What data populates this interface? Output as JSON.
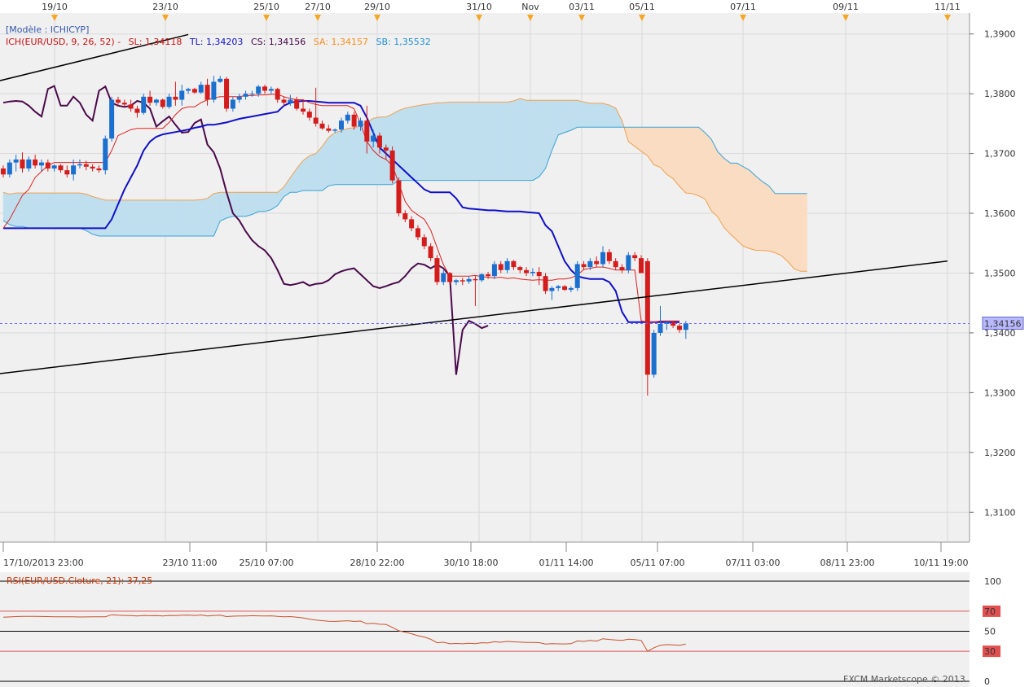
{
  "chart_data": {
    "type": "candlestick",
    "template_label": "[Modèle : ICHICYP]",
    "legend": {
      "ich": "ICH(EUR/USD, 9, 26, 52) -",
      "sl": "SL: 1,34118",
      "tl": "TL: 1,34203",
      "cs": "CS: 1,34156",
      "sa": "SA: 1,34157",
      "sb": "SB: 1,35532"
    },
    "current_price": "1,34156",
    "y_ticks": [
      "1,3900",
      "1,3800",
      "1,3700",
      "1,3600",
      "1,3500",
      "1,3400",
      "1,3300",
      "1,3200",
      "1,3100"
    ],
    "y_range": [
      1.305,
      1.3935
    ],
    "top_dates": [
      "19/10",
      "23/10",
      "25/10",
      "27/10",
      "29/10",
      "31/10",
      "Nov",
      "03/11",
      "05/11",
      "07/11",
      "09/11",
      "11/11"
    ],
    "bottom_dates": [
      "17/10/2013 23:00",
      "23/10 11:00",
      "25/10 07:00",
      "28/10 22:00",
      "30/10 18:00",
      "01/11 14:00",
      "05/11 07:00",
      "07/11 03:00",
      "08/11 23:00",
      "10/11 19:00"
    ],
    "candles": [
      [
        1.3675,
        1.368,
        1.366,
        1.3665
      ],
      [
        1.3665,
        1.369,
        1.366,
        1.3685
      ],
      [
        1.3685,
        1.3698,
        1.367,
        1.369
      ],
      [
        1.369,
        1.3702,
        1.3668,
        1.3675
      ],
      [
        1.3675,
        1.3695,
        1.367,
        1.369
      ],
      [
        1.369,
        1.3698,
        1.3675,
        1.368
      ],
      [
        1.368,
        1.369,
        1.367,
        1.3685
      ],
      [
        1.3685,
        1.369,
        1.367,
        1.3675
      ],
      [
        1.3675,
        1.3682,
        1.367,
        1.368
      ],
      [
        1.368,
        1.3682,
        1.3668,
        1.3672
      ],
      [
        1.3672,
        1.368,
        1.366,
        1.3665
      ],
      [
        1.3665,
        1.369,
        1.3655,
        1.368
      ],
      [
        1.368,
        1.369,
        1.3675,
        1.3682
      ],
      [
        1.3682,
        1.3688,
        1.3672,
        1.3678
      ],
      [
        1.3678,
        1.3682,
        1.367,
        1.3675
      ],
      [
        1.3675,
        1.368,
        1.3668,
        1.3672
      ],
      [
        1.3672,
        1.373,
        1.3665,
        1.3725
      ],
      [
        1.3725,
        1.3795,
        1.372,
        1.379
      ],
      [
        1.379,
        1.3795,
        1.378,
        1.3785
      ],
      [
        1.3785,
        1.379,
        1.3778,
        1.3782
      ],
      [
        1.3782,
        1.379,
        1.377,
        1.3775
      ],
      [
        1.3775,
        1.378,
        1.376,
        1.3768
      ],
      [
        1.3768,
        1.38,
        1.3765,
        1.3795
      ],
      [
        1.3795,
        1.3805,
        1.378,
        1.3785
      ],
      [
        1.3785,
        1.3792,
        1.378,
        1.379
      ],
      [
        1.379,
        1.3792,
        1.3775,
        1.3778
      ],
      [
        1.3778,
        1.38,
        1.3775,
        1.3795
      ],
      [
        1.3795,
        1.382,
        1.378,
        1.379
      ],
      [
        1.379,
        1.3815,
        1.378,
        1.3805
      ],
      [
        1.3805,
        1.381,
        1.38,
        1.3808
      ],
      [
        1.3808,
        1.381,
        1.38,
        1.3802
      ],
      [
        1.3802,
        1.382,
        1.38,
        1.3815
      ],
      [
        1.3815,
        1.3825,
        1.378,
        1.379
      ],
      [
        1.379,
        1.383,
        1.3785,
        1.382
      ],
      [
        1.382,
        1.383,
        1.3818,
        1.3825
      ],
      [
        1.3825,
        1.3828,
        1.377,
        1.3775
      ],
      [
        1.3775,
        1.3795,
        1.377,
        1.379
      ],
      [
        1.379,
        1.38,
        1.3785,
        1.3795
      ],
      [
        1.3795,
        1.3805,
        1.379,
        1.38
      ],
      [
        1.38,
        1.3805,
        1.3795,
        1.38
      ],
      [
        1.38,
        1.3815,
        1.3795,
        1.3812
      ],
      [
        1.3812,
        1.3815,
        1.38,
        1.3805
      ],
      [
        1.3805,
        1.3812,
        1.38,
        1.3808
      ],
      [
        1.3808,
        1.381,
        1.3785,
        1.379
      ],
      [
        1.379,
        1.3795,
        1.378,
        1.3785
      ],
      [
        1.3785,
        1.3798,
        1.378,
        1.379
      ],
      [
        1.379,
        1.3795,
        1.3772,
        1.3775
      ],
      [
        1.3775,
        1.379,
        1.3765,
        1.377
      ],
      [
        1.377,
        1.3775,
        1.3755,
        1.376
      ],
      [
        1.376,
        1.381,
        1.3745,
        1.375
      ],
      [
        1.375,
        1.3755,
        1.374,
        1.3742
      ],
      [
        1.3742,
        1.3748,
        1.3735,
        1.3738
      ],
      [
        1.3738,
        1.3742,
        1.3735,
        1.374
      ],
      [
        1.374,
        1.376,
        1.3735,
        1.3755
      ],
      [
        1.3755,
        1.377,
        1.375,
        1.3765
      ],
      [
        1.3765,
        1.377,
        1.374,
        1.3745
      ],
      [
        1.3745,
        1.376,
        1.3738,
        1.3755
      ],
      [
        1.3755,
        1.378,
        1.37,
        1.372
      ],
      [
        1.372,
        1.374,
        1.371,
        1.373
      ],
      [
        1.373,
        1.3735,
        1.37,
        1.371
      ],
      [
        1.371,
        1.3715,
        1.369,
        1.3705
      ],
      [
        1.3705,
        1.3712,
        1.365,
        1.3655
      ],
      [
        1.3655,
        1.366,
        1.3595,
        1.36
      ],
      [
        1.36,
        1.3605,
        1.3585,
        1.359
      ],
      [
        1.359,
        1.3595,
        1.357,
        1.3575
      ],
      [
        1.3575,
        1.358,
        1.3555,
        1.356
      ],
      [
        1.356,
        1.3565,
        1.354,
        1.3545
      ],
      [
        1.3545,
        1.355,
        1.352,
        1.3525
      ],
      [
        1.3525,
        1.353,
        1.348,
        1.3485
      ],
      [
        1.3485,
        1.3505,
        1.348,
        1.35
      ],
      [
        1.35,
        1.3502,
        1.348,
        1.3485
      ],
      [
        1.3485,
        1.349,
        1.348,
        1.3488
      ],
      [
        1.3488,
        1.3492,
        1.348,
        1.3486
      ],
      [
        1.3486,
        1.3495,
        1.3482,
        1.349
      ],
      [
        1.349,
        1.3495,
        1.3445,
        1.3488
      ],
      [
        1.3488,
        1.35,
        1.3485,
        1.3498
      ],
      [
        1.3498,
        1.3502,
        1.349,
        1.3495
      ],
      [
        1.3495,
        1.352,
        1.349,
        1.3515
      ],
      [
        1.3515,
        1.352,
        1.35,
        1.3505
      ],
      [
        1.3505,
        1.3525,
        1.35,
        1.352
      ],
      [
        1.352,
        1.3522,
        1.3505,
        1.351
      ],
      [
        1.351,
        1.3512,
        1.35,
        1.3505
      ],
      [
        1.3505,
        1.351,
        1.3495,
        1.35
      ],
      [
        1.35,
        1.3508,
        1.3495,
        1.3502
      ],
      [
        1.3502,
        1.351,
        1.348,
        1.3495
      ],
      [
        1.3495,
        1.35,
        1.3465,
        1.347
      ],
      [
        1.347,
        1.3478,
        1.3455,
        1.3475
      ],
      [
        1.3475,
        1.348,
        1.347,
        1.3478
      ],
      [
        1.3478,
        1.348,
        1.347,
        1.3472
      ],
      [
        1.3472,
        1.3478,
        1.3468,
        1.3475
      ],
      [
        1.3475,
        1.352,
        1.347,
        1.3515
      ],
      [
        1.3515,
        1.352,
        1.3505,
        1.351
      ],
      [
        1.351,
        1.3525,
        1.3505,
        1.352
      ],
      [
        1.352,
        1.3528,
        1.351,
        1.3515
      ],
      [
        1.3515,
        1.3545,
        1.351,
        1.3535
      ],
      [
        1.3535,
        1.354,
        1.3515,
        1.352
      ],
      [
        1.352,
        1.3525,
        1.3505,
        1.351
      ],
      [
        1.351,
        1.3515,
        1.35,
        1.3505
      ],
      [
        1.3505,
        1.3535,
        1.35,
        1.353
      ],
      [
        1.353,
        1.3535,
        1.352,
        1.3525
      ],
      [
        1.3525,
        1.353,
        1.35,
        1.35
      ],
      [
        1.352,
        1.3525,
        1.3295,
        1.333
      ],
      [
        1.333,
        1.3405,
        1.3325,
        1.34
      ],
      [
        1.34,
        1.3445,
        1.3395,
        1.3415
      ],
      [
        1.3415,
        1.342,
        1.3405,
        1.3418
      ],
      [
        1.3418,
        1.342,
        1.3408,
        1.3412
      ],
      [
        1.3412,
        1.3415,
        1.34,
        1.3405
      ],
      [
        1.3405,
        1.342,
        1.339,
        1.3416
      ]
    ],
    "tenkan_sen": [
      1.3575,
      1.359,
      1.361,
      1.363,
      1.364,
      1.366,
      1.367,
      1.368,
      1.3685,
      1.3685,
      1.3685,
      1.3685,
      1.3685,
      1.3685,
      1.3685,
      1.3685,
      1.3685,
      1.3705,
      1.373,
      1.3735,
      1.374,
      1.3742,
      1.3742,
      1.3742,
      1.3742,
      1.3742,
      1.3752,
      1.3765,
      1.3775,
      1.3778,
      1.3778,
      1.3785,
      1.379,
      1.3793,
      1.3795,
      1.3795,
      1.3795,
      1.3795,
      1.3797,
      1.3797,
      1.3798,
      1.3798,
      1.3799,
      1.3799,
      1.3795,
      1.3792,
      1.379,
      1.379,
      1.3785,
      1.3782,
      1.378,
      1.378,
      1.378,
      1.378,
      1.378,
      1.3775,
      1.375,
      1.372,
      1.3705,
      1.3695,
      1.369,
      1.368,
      1.365,
      1.362,
      1.3605,
      1.3597,
      1.359,
      1.3572,
      1.3543,
      1.3514,
      1.3495,
      1.3495,
      1.3495,
      1.3495,
      1.3496,
      1.3494,
      1.3493,
      1.3492,
      1.3493,
      1.3491,
      1.3492,
      1.349,
      1.3489,
      1.3488,
      1.3489,
      1.3488,
      1.3488,
      1.349,
      1.349,
      1.3492,
      1.3497,
      1.3506,
      1.3508,
      1.351,
      1.351,
      1.3508,
      1.3505,
      1.3505,
      1.3505,
      1.3505,
      1.342,
      1.3418,
      1.3418,
      1.342,
      1.342,
      1.342,
      1.342
    ],
    "kijun_sen": [
      1.3575,
      1.3575,
      1.3575,
      1.3575,
      1.3575,
      1.3575,
      1.3575,
      1.3575,
      1.3575,
      1.3575,
      1.3575,
      1.3575,
      1.3575,
      1.3575,
      1.3575,
      1.3575,
      1.3575,
      1.359,
      1.3615,
      1.364,
      1.366,
      1.368,
      1.3705,
      1.372,
      1.3728,
      1.3732,
      1.3734,
      1.3736,
      1.3738,
      1.374,
      1.3743,
      1.3745,
      1.3748,
      1.3748,
      1.375,
      1.3752,
      1.3755,
      1.3758,
      1.376,
      1.3762,
      1.3764,
      1.3766,
      1.3768,
      1.377,
      1.378,
      1.3785,
      1.3787,
      1.3788,
      1.3788,
      1.3787,
      1.3786,
      1.3785,
      1.3785,
      1.3785,
      1.3785,
      1.3785,
      1.378,
      1.376,
      1.3735,
      1.371,
      1.37,
      1.369,
      1.368,
      1.367,
      1.366,
      1.365,
      1.364,
      1.3635,
      1.3635,
      1.3635,
      1.3635,
      1.3625,
      1.361,
      1.3608,
      1.3607,
      1.3606,
      1.3605,
      1.3605,
      1.3604,
      1.3603,
      1.3603,
      1.3603,
      1.3602,
      1.3601,
      1.36,
      1.358,
      1.357,
      1.3545,
      1.352,
      1.3505,
      1.3495,
      1.3492,
      1.349,
      1.349,
      1.349,
      1.3485,
      1.347,
      1.3435,
      1.3418,
      1.3418,
      1.3418,
      1.3418,
      1.3418,
      1.3418,
      1.3418,
      1.3418,
      1.3418
    ],
    "chikou_span": [
      1.3785,
      1.3787,
      1.3788,
      1.3787,
      1.378,
      1.377,
      1.3762,
      1.3808,
      1.3813,
      1.378,
      1.378,
      1.3795,
      1.3785,
      1.3765,
      1.3755,
      1.3805,
      1.3812,
      1.3785,
      1.378,
      1.3778,
      1.378,
      1.3788,
      1.3785,
      1.3775,
      1.3745,
      1.3754,
      1.3762,
      1.3748,
      1.3735,
      1.3736,
      1.3751,
      1.3757,
      1.3715,
      1.3702,
      1.3675,
      1.3635,
      1.36,
      1.3588,
      1.357,
      1.3555,
      1.3545,
      1.3538,
      1.3525,
      1.3505,
      1.3482,
      1.348,
      1.3482,
      1.3485,
      1.3479,
      1.3482,
      1.3483,
      1.3488,
      1.3498,
      1.3503,
      1.3506,
      1.3508,
      1.3498,
      1.3488,
      1.3478,
      1.3475,
      1.3478,
      1.3482,
      1.3485,
      1.3495,
      1.3508,
      1.3516,
      1.3514,
      1.3508,
      1.3514,
      1.3508,
      1.3495,
      1.333,
      1.3405,
      1.342,
      1.3415,
      1.3408,
      1.3412
    ],
    "senkou_a": [
      1.3635,
      1.3632,
      1.3634,
      1.3634,
      1.3634,
      1.3634,
      1.3634,
      1.3634,
      1.3634,
      1.3634,
      1.3634,
      1.3634,
      1.3634,
      1.3632,
      1.3628,
      1.3625,
      1.3622,
      1.3622,
      1.3622,
      1.3622,
      1.3622,
      1.3622,
      1.3622,
      1.3622,
      1.3622,
      1.3622,
      1.3622,
      1.3622,
      1.3622,
      1.3622,
      1.3622,
      1.3623,
      1.3625,
      1.3633,
      1.3635,
      1.3635,
      1.3635,
      1.3635,
      1.3635,
      1.3635,
      1.3635,
      1.3635,
      1.3635,
      1.3635,
      1.3644,
      1.366,
      1.3675,
      1.3688,
      1.3696,
      1.37,
      1.3712,
      1.3727,
      1.3735,
      1.3738,
      1.3742,
      1.3743,
      1.3746,
      1.3752,
      1.3759,
      1.3761,
      1.3761,
      1.3766,
      1.3772,
      1.3776,
      1.3778,
      1.378,
      1.3782,
      1.3783,
      1.3785,
      1.3785,
      1.3786,
      1.3786,
      1.3786,
      1.3786,
      1.3786,
      1.3786,
      1.3786,
      1.3786,
      1.3786,
      1.3786,
      1.3788,
      1.3792,
      1.3789,
      1.3789,
      1.3789,
      1.3789,
      1.3789,
      1.3789,
      1.3789,
      1.3789,
      1.3789,
      1.3786,
      1.3784,
      1.3784,
      1.3784,
      1.3781,
      1.3776,
      1.3755,
      1.372,
      1.3712,
      1.3704,
      1.3696,
      1.3681,
      1.3677,
      1.3665,
      1.3658,
      1.3645,
      1.3634,
      1.3633,
      1.3629,
      1.3624,
      1.3604,
      1.3594,
      1.3576,
      1.3565,
      1.3555,
      1.3545,
      1.3541,
      1.3538,
      1.3538,
      1.3537,
      1.3534,
      1.3529,
      1.3519,
      1.3507,
      1.3503,
      1.3503
    ],
    "senkou_b": [
      1.3588,
      1.3581,
      1.3578,
      1.3578,
      1.3575,
      1.3575,
      1.3575,
      1.3575,
      1.3575,
      1.3575,
      1.3575,
      1.3575,
      1.3575,
      1.3571,
      1.3565,
      1.3562,
      1.3562,
      1.3562,
      1.3562,
      1.3562,
      1.3562,
      1.3562,
      1.3562,
      1.3562,
      1.3562,
      1.3562,
      1.3562,
      1.3562,
      1.3562,
      1.3562,
      1.3562,
      1.3562,
      1.3562,
      1.3562,
      1.3587,
      1.3592,
      1.3595,
      1.3595,
      1.3595,
      1.3598,
      1.3603,
      1.3603,
      1.3606,
      1.3613,
      1.3628,
      1.3635,
      1.3635,
      1.3638,
      1.3638,
      1.3638,
      1.3638,
      1.3646,
      1.3648,
      1.3648,
      1.3648,
      1.3648,
      1.3648,
      1.3648,
      1.3648,
      1.3648,
      1.3648,
      1.3648,
      1.3655,
      1.3655,
      1.3655,
      1.3655,
      1.3655,
      1.3655,
      1.3655,
      1.3655,
      1.3655,
      1.3655,
      1.3655,
      1.3655,
      1.3655,
      1.3655,
      1.3655,
      1.3655,
      1.3655,
      1.3655,
      1.3655,
      1.3655,
      1.3655,
      1.3655,
      1.3661,
      1.3675,
      1.3705,
      1.3731,
      1.3735,
      1.3739,
      1.3744,
      1.3744,
      1.3744,
      1.3744,
      1.3744,
      1.3744,
      1.3744,
      1.3744,
      1.3744,
      1.3744,
      1.3744,
      1.3744,
      1.3744,
      1.3744,
      1.3744,
      1.3744,
      1.3744,
      1.3744,
      1.3744,
      1.3744,
      1.3735,
      1.3724,
      1.3703,
      1.3692,
      1.3684,
      1.3684,
      1.3678,
      1.3672,
      1.3662,
      1.3653,
      1.3646,
      1.3633,
      1.3633,
      1.3633,
      1.3633,
      1.3633,
      1.3633
    ],
    "trendlines": [
      {
        "x1": -2,
        "y1": 1.333,
        "x2": 148,
        "y2": 1.352
      },
      {
        "x1": -2,
        "y1": 1.3818,
        "x2": 29,
        "y2": 1.3899
      }
    ],
    "rsi": {
      "label": "RSI(EUR/USD.Cloture, 21): 37,25",
      "value": 37.25,
      "levels": [
        "100",
        "70",
        "50",
        "30",
        "0"
      ],
      "values": [
        64,
        64.3,
        64.6,
        64.8,
        64.9,
        64.8,
        64.7,
        64.6,
        64.5,
        64.5,
        64.4,
        64.4,
        64.2,
        64.3,
        64.5,
        64.4,
        64.5,
        66.5,
        66,
        65.8,
        65.6,
        65.3,
        65.8,
        65.5,
        65.7,
        65.2,
        65.8,
        65.6,
        66,
        66.2,
        65.8,
        66.3,
        65.2,
        65.8,
        66,
        64.6,
        65,
        65.3,
        65.2,
        65.5,
        65.4,
        65.2,
        65.4,
        64.8,
        64.5,
        64.6,
        64,
        63.3,
        62.1,
        61.2,
        60.6,
        59.9,
        59.8,
        60.2,
        60.5,
        59.8,
        60.2,
        57.5,
        58,
        57,
        56.8,
        53.8,
        50.5,
        49,
        47.5,
        45.5,
        44.2,
        42,
        38.5,
        39,
        37.5,
        37.8,
        37.5,
        38,
        37.6,
        38.5,
        38.3,
        39.5,
        39,
        39.8,
        39.4,
        39.1,
        38.8,
        38.9,
        38.6,
        37.2,
        37.6,
        37.4,
        37.3,
        37.6,
        40.3,
        39.8,
        40.8,
        40.2,
        42.5,
        41.8,
        41.2,
        40.8,
        42,
        41.6,
        40.8,
        30,
        33.5,
        36,
        36.7,
        36.4,
        36,
        37.25
      ]
    },
    "watermark": "FXCM Marketscope © 2013"
  }
}
